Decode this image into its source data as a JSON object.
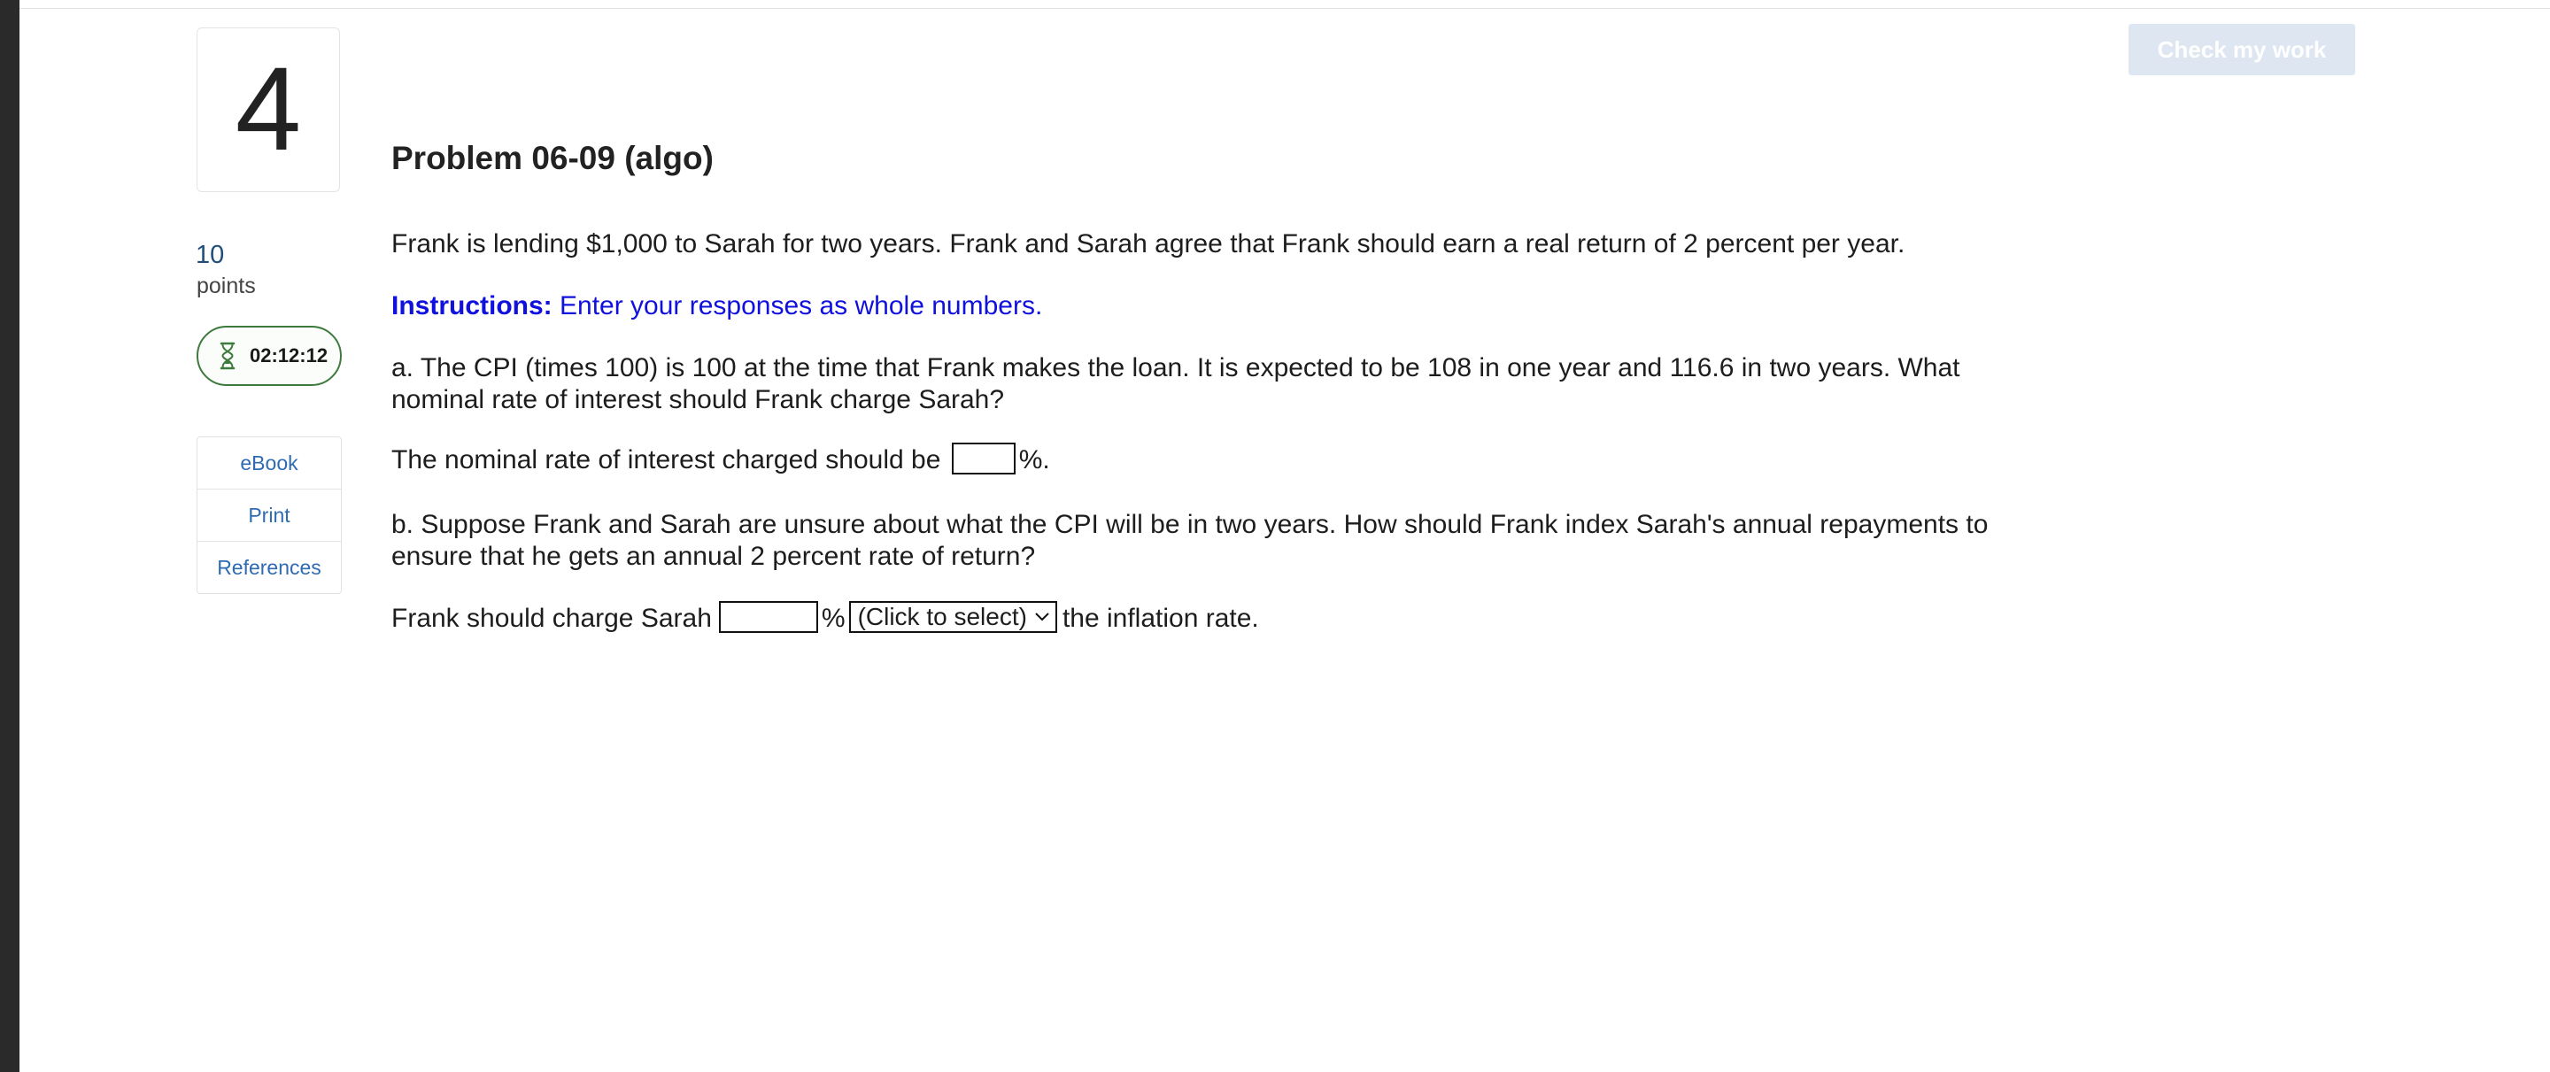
{
  "question": {
    "number": "4",
    "points_value": "10",
    "points_label": "points",
    "timer": "02:12:12"
  },
  "side_links": [
    "eBook",
    "Print",
    "References"
  ],
  "check_button": "Check my work",
  "problem": {
    "title": "Problem 06-09 (algo)",
    "intro": "Frank is lending $1,000 to Sarah for two years. Frank and Sarah agree that Frank should earn a real return of 2 percent per year.",
    "instructions_label": "Instructions:",
    "instructions_text": " Enter your responses as whole numbers.",
    "part_a": "a. The CPI (times 100) is 100 at the time that Frank makes the loan. It is expected to be 108 in one year and 116.6 in two years. What nominal rate of interest should Frank charge Sarah?",
    "answer_a_prefix": "The nominal rate of interest charged should be",
    "answer_a_value": "",
    "answer_a_suffix": "%.",
    "part_b": "b. Suppose Frank and Sarah are unsure about what the CPI will be in two years. How should Frank index Sarah's annual repayments to ensure that he gets an annual 2 percent rate of return?",
    "answer_b_prefix": "Frank should charge Sarah",
    "answer_b_value": "",
    "answer_b_percent": "%",
    "answer_b_select": "(Click to select)",
    "answer_b_suffix": "the inflation rate."
  },
  "colors": {
    "link": "#2f6bb3",
    "instructions": "#1111dd",
    "timer_border": "#3d7a3d",
    "check_button_bg": "#dde6f1"
  },
  "icons": {
    "timer": "hourglass-icon",
    "select": "chevron-down-icon"
  }
}
